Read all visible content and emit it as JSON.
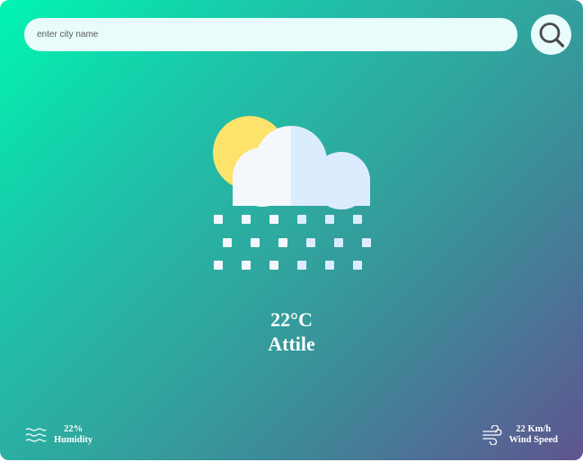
{
  "search": {
    "placeholder": "enter city name"
  },
  "icons": {
    "search_button": "search-icon",
    "weather": "snow-cloud-sun-icon",
    "humidity": "humidity-waves-icon",
    "wind": "wind-icon"
  },
  "weather": {
    "temperature": "22°C",
    "city": "Attile"
  },
  "details": {
    "humidity_value": "22%",
    "humidity_label": "Humidity",
    "wind_value": "22 Km/h",
    "wind_label": "Wind Speed"
  },
  "colors": {
    "gradient_start": "#00f5b2",
    "gradient_end": "#5f558e",
    "search_bg": "#e8fcfb",
    "sun": "#fde26c",
    "cloud_light": "#f4f8fd",
    "cloud_shade": "#dcecff"
  }
}
